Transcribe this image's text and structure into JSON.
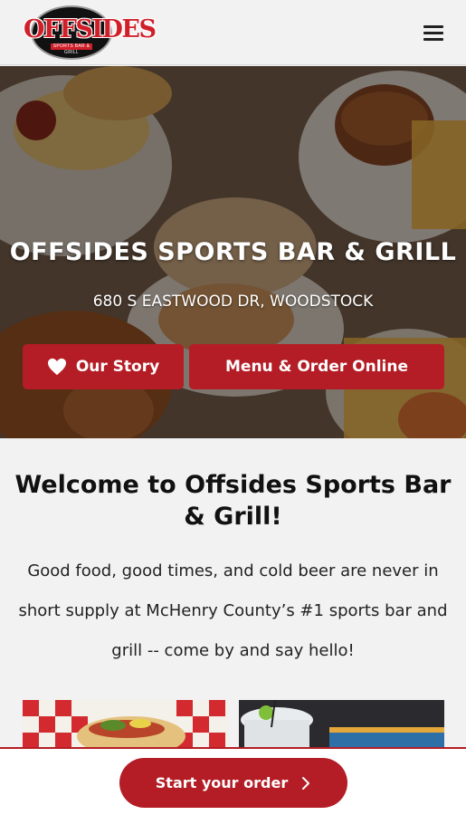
{
  "header": {
    "logo_text": "OFFSIDES",
    "logo_subtext": "SPORTS BAR & GRILL",
    "menu_icon": "hamburger-menu-icon"
  },
  "hero": {
    "title": "OFFSIDES SPORTS BAR & GRILL",
    "address": "680 S EASTWOOD DR, WOODSTOCK",
    "our_story_label": "Our Story",
    "our_story_icon": "heart-icon",
    "menu_order_label": "Menu & Order Online"
  },
  "welcome": {
    "title": "Welcome to Offsides Sports Bar & Grill!",
    "body": "Good food, good times, and cold beer are never in short supply at McHenry County’s #1 sports bar and grill -- come by and say hello!"
  },
  "order_bar": {
    "label": "Start your order",
    "icon": "chevron-right-icon"
  },
  "colors": {
    "accent": "#b41d25",
    "background": "#f2f2f2",
    "text": "#111111"
  }
}
